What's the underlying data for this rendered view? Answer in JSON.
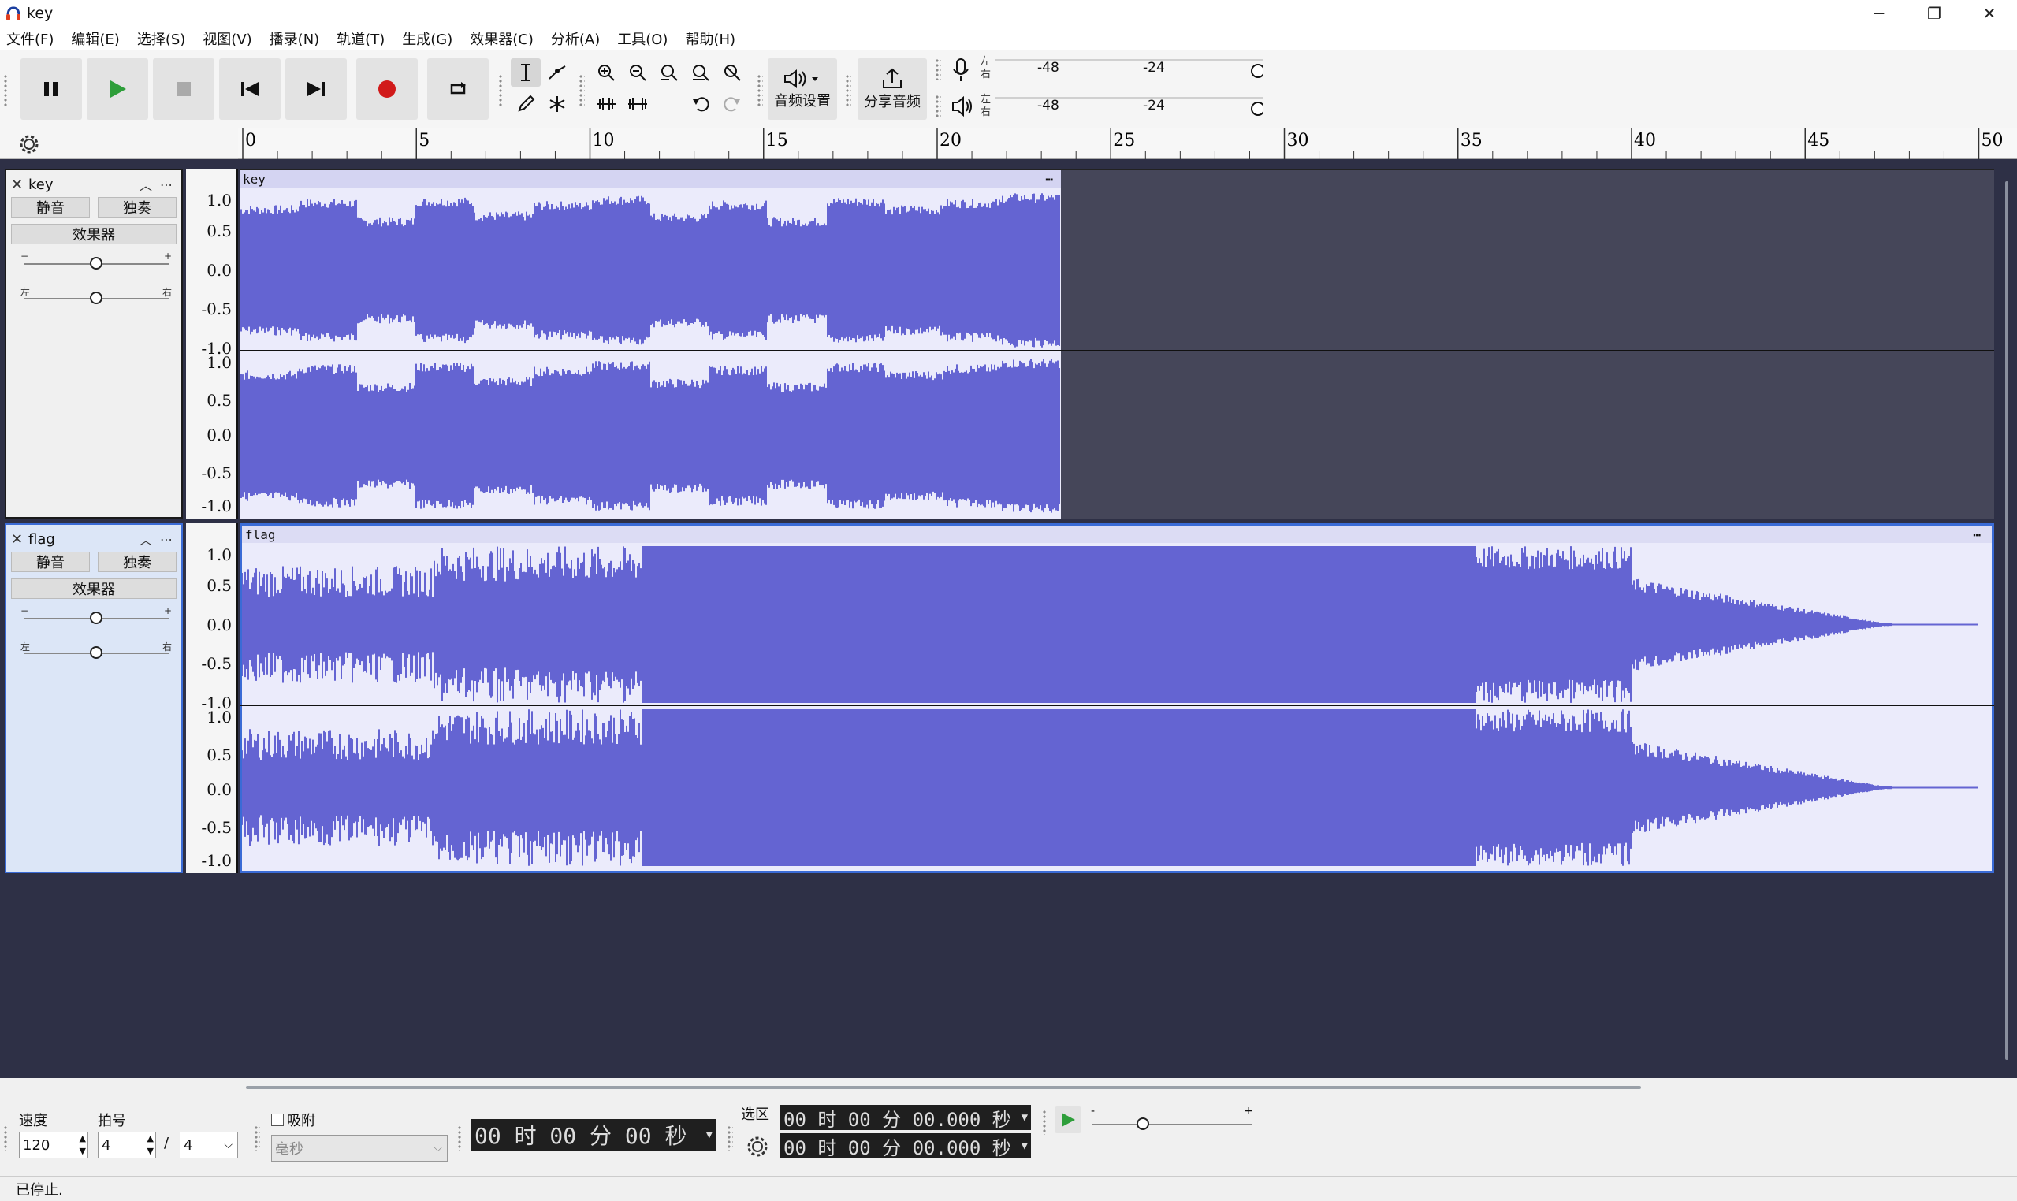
{
  "window": {
    "title": "key",
    "minimize": "─",
    "restore": "❐",
    "close": "✕"
  },
  "menu": [
    "文件(F)",
    "编辑(E)",
    "选择(S)",
    "视图(V)",
    "播录(N)",
    "轨道(T)",
    "生成(G)",
    "效果器(C)",
    "分析(A)",
    "工具(O)",
    "帮助(H)"
  ],
  "toolbar": {
    "audio_setup_label": "音频设置",
    "share_audio_label": "分享音频",
    "meter": {
      "left_short": "左",
      "right_short": "右",
      "tick_a": "-48",
      "tick_b": "-24"
    }
  },
  "ruler": {
    "ticks": [
      "0",
      "5",
      "10",
      "15",
      "20",
      "25",
      "30",
      "35",
      "40",
      "45",
      "50"
    ]
  },
  "tracks": [
    {
      "name": "key",
      "clip_name": "key",
      "mute": "静音",
      "solo": "独奏",
      "effects": "效果器",
      "gain_minus": "−",
      "gain_plus": "+",
      "pan_left": "左",
      "pan_right": "右",
      "scale_top": [
        "1.0",
        "0.5",
        "0.0",
        "-0.5",
        "-1.0"
      ],
      "scale_bottom": [
        "1.0",
        "0.5",
        "0.0",
        "-0.5",
        "-1.0"
      ]
    },
    {
      "name": "flag",
      "clip_name": "flag",
      "mute": "静音",
      "solo": "独奏",
      "effects": "效果器",
      "gain_minus": "−",
      "gain_plus": "+",
      "pan_left": "左",
      "pan_right": "右",
      "scale_top": [
        "1.0",
        "0.5",
        "0.0",
        "-0.5",
        "-1.0"
      ],
      "scale_bottom": [
        "1.0",
        "0.5",
        "0.0",
        "-0.5",
        "-1.0"
      ]
    }
  ],
  "bottom": {
    "tempo_label": "速度",
    "tempo_value": "120",
    "meter_label": "拍号",
    "meter_top": "4",
    "meter_sep": "/",
    "meter_bottom": "4",
    "snap_label": "吸附",
    "snap_unit": "毫秒",
    "time_main": "00 时 00 分 00 秒",
    "selection_label": "选区",
    "sel_start": "00 时 00 分 00.000 秒",
    "sel_end": "00 时 00 分 00.000 秒",
    "speed_minus": "-",
    "speed_plus": "+"
  },
  "status": "已停止."
}
